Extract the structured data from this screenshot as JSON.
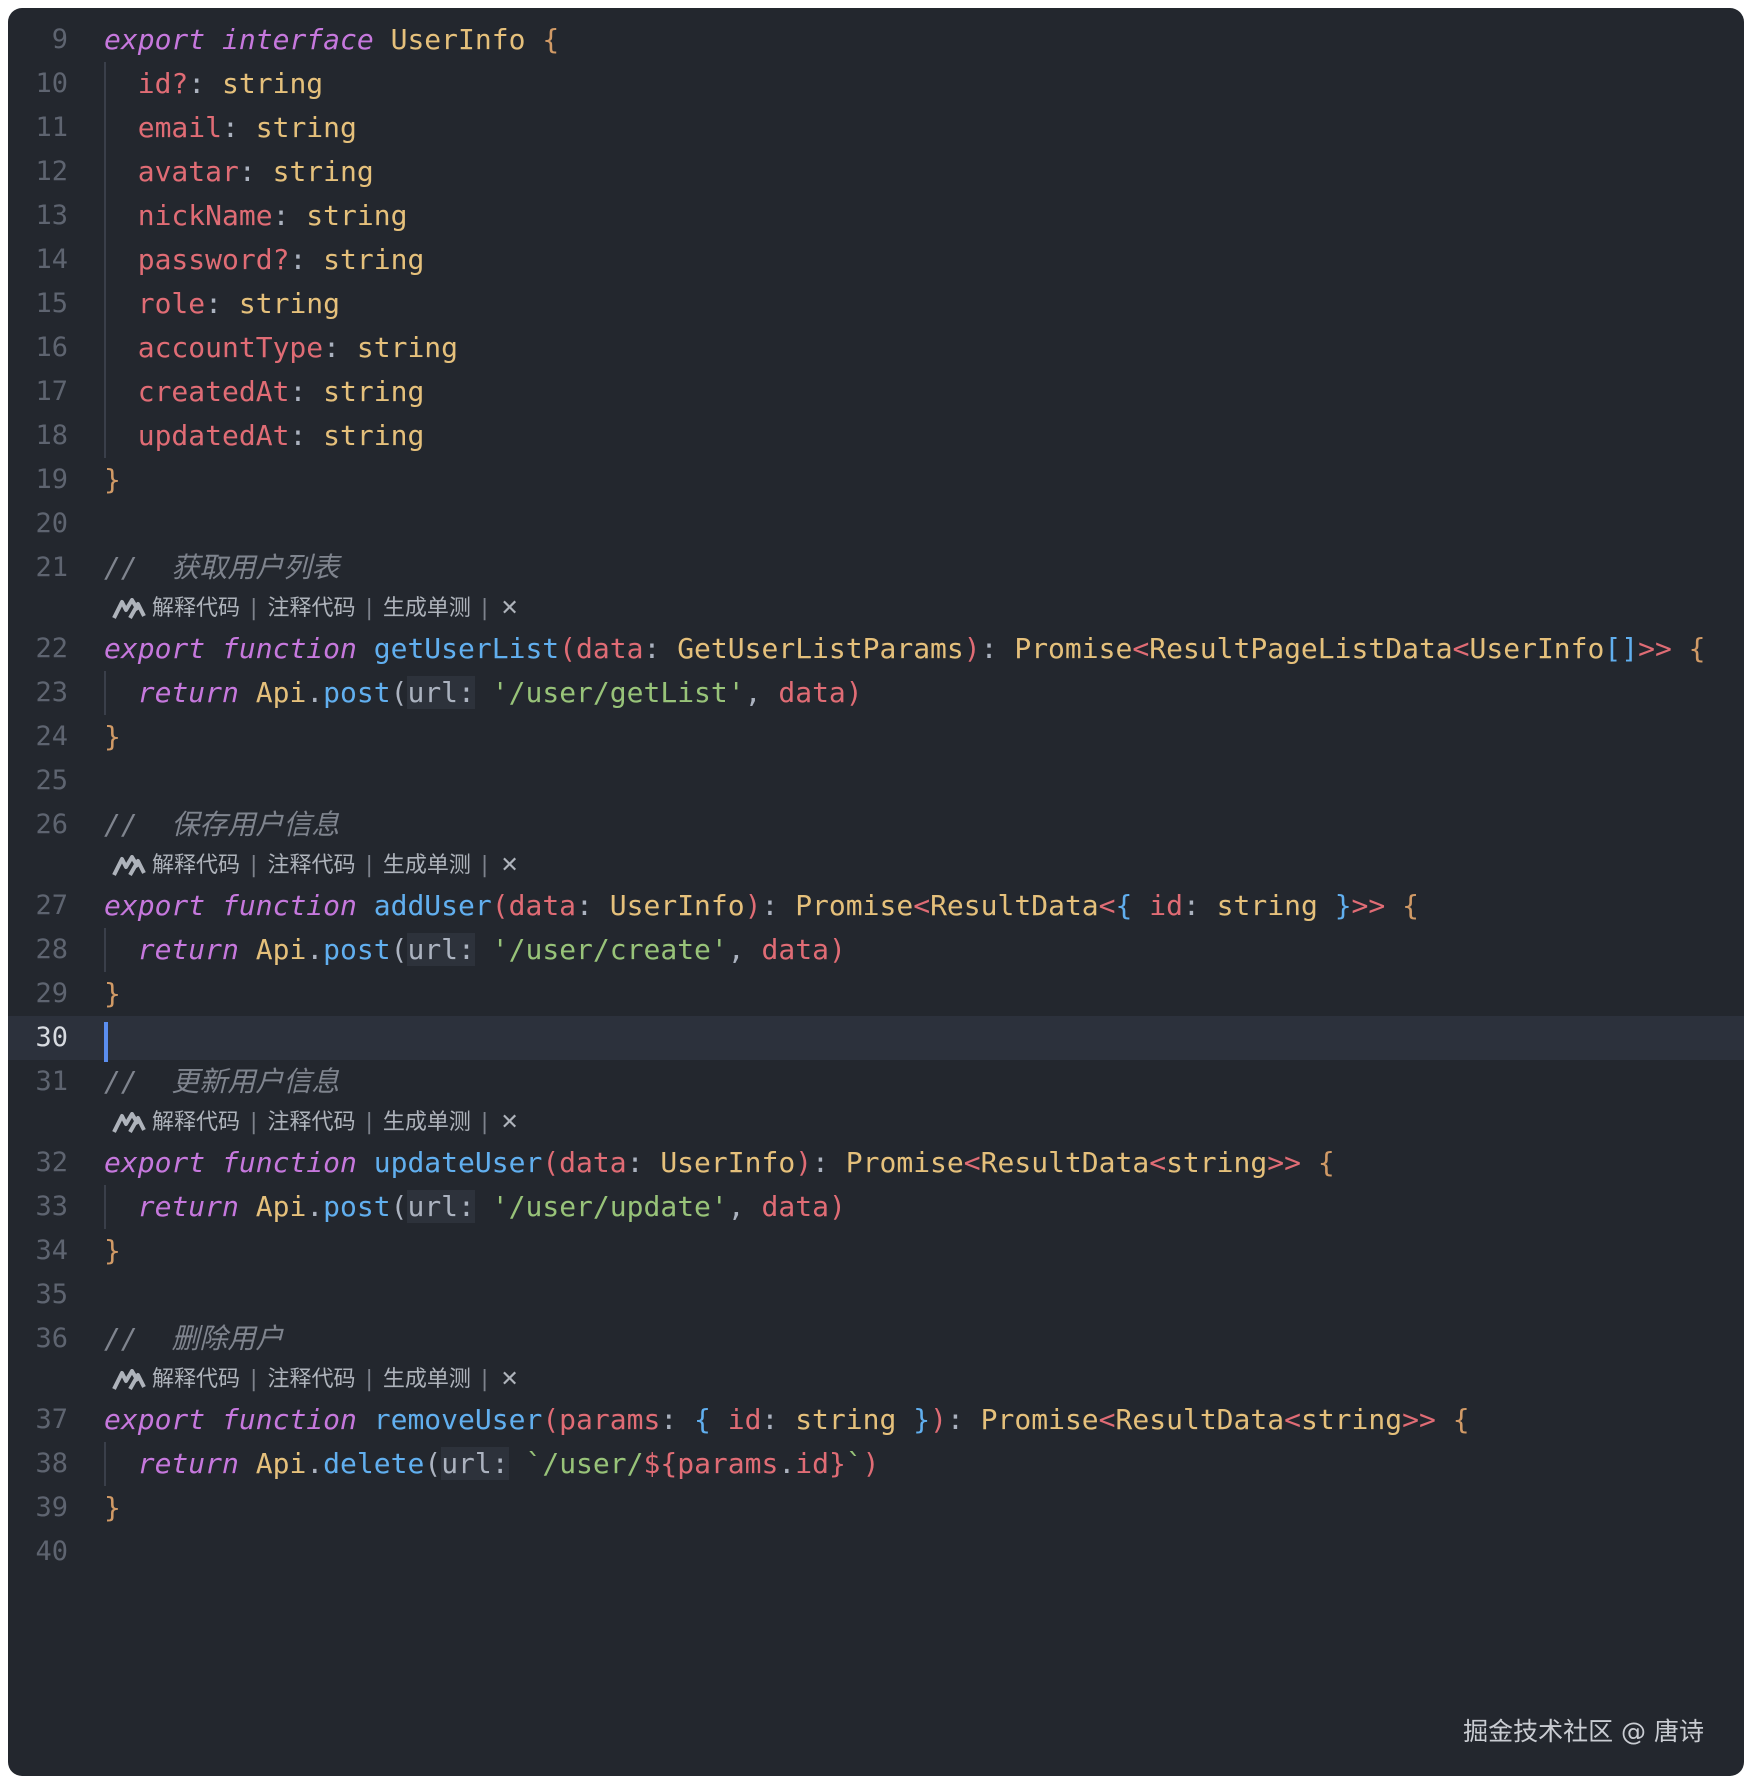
{
  "editor": {
    "active_line": 30,
    "lines": [
      {
        "n": "9",
        "tokens": [
          [
            "kw",
            "export"
          ],
          [
            "pu",
            " "
          ],
          [
            "kw",
            "interface"
          ],
          [
            "pu",
            " "
          ],
          [
            "ty",
            "UserInfo"
          ],
          [
            "pu",
            " "
          ],
          [
            "br",
            "{"
          ]
        ]
      },
      {
        "n": "10",
        "guide": true,
        "tokens": [
          [
            "pu",
            "  "
          ],
          [
            "pr",
            "id?"
          ],
          [
            "pu",
            ": "
          ],
          [
            "ty",
            "string"
          ]
        ]
      },
      {
        "n": "11",
        "guide": true,
        "tokens": [
          [
            "pu",
            "  "
          ],
          [
            "pr",
            "email"
          ],
          [
            "pu",
            ": "
          ],
          [
            "ty",
            "string"
          ]
        ]
      },
      {
        "n": "12",
        "guide": true,
        "tokens": [
          [
            "pu",
            "  "
          ],
          [
            "pr",
            "avatar"
          ],
          [
            "pu",
            ": "
          ],
          [
            "ty",
            "string"
          ]
        ]
      },
      {
        "n": "13",
        "guide": true,
        "tokens": [
          [
            "pu",
            "  "
          ],
          [
            "pr",
            "nickName"
          ],
          [
            "pu",
            ": "
          ],
          [
            "ty",
            "string"
          ]
        ]
      },
      {
        "n": "14",
        "guide": true,
        "tokens": [
          [
            "pu",
            "  "
          ],
          [
            "pr",
            "password?"
          ],
          [
            "pu",
            ": "
          ],
          [
            "ty",
            "string"
          ]
        ]
      },
      {
        "n": "15",
        "guide": true,
        "tokens": [
          [
            "pu",
            "  "
          ],
          [
            "pr",
            "role"
          ],
          [
            "pu",
            ": "
          ],
          [
            "ty",
            "string"
          ]
        ]
      },
      {
        "n": "16",
        "guide": true,
        "tokens": [
          [
            "pu",
            "  "
          ],
          [
            "pr",
            "accountType"
          ],
          [
            "pu",
            ": "
          ],
          [
            "ty",
            "string"
          ]
        ]
      },
      {
        "n": "17",
        "guide": true,
        "tokens": [
          [
            "pu",
            "  "
          ],
          [
            "pr",
            "createdAt"
          ],
          [
            "pu",
            ": "
          ],
          [
            "ty",
            "string"
          ]
        ]
      },
      {
        "n": "18",
        "guide": true,
        "tokens": [
          [
            "pu",
            "  "
          ],
          [
            "pr",
            "updatedAt"
          ],
          [
            "pu",
            ": "
          ],
          [
            "ty",
            "string"
          ]
        ]
      },
      {
        "n": "19",
        "tokens": [
          [
            "br",
            "}"
          ]
        ]
      },
      {
        "n": "20",
        "tokens": []
      },
      {
        "n": "21",
        "tokens": [
          [
            "cm",
            "//  获取用户列表"
          ]
        ]
      },
      {
        "lens": true
      },
      {
        "n": "22",
        "tokens": [
          [
            "kw",
            "export"
          ],
          [
            "pu",
            " "
          ],
          [
            "kw",
            "function"
          ],
          [
            "pu",
            " "
          ],
          [
            "fn",
            "getUserList"
          ],
          [
            "pr",
            "("
          ],
          [
            "pr",
            "data"
          ],
          [
            "pu",
            ": "
          ],
          [
            "ty",
            "GetUserListParams"
          ],
          [
            "pr",
            ")"
          ],
          [
            "pu",
            ": "
          ],
          [
            "ty",
            "Promise"
          ],
          [
            "pr",
            "<"
          ],
          [
            "ty",
            "ResultPageListData"
          ],
          [
            "pr",
            "<"
          ],
          [
            "ty",
            "UserInfo"
          ],
          [
            "fn",
            "[]"
          ],
          [
            "pr",
            ">>"
          ],
          [
            "pu",
            " "
          ],
          [
            "br",
            "{"
          ]
        ]
      },
      {
        "n": "23",
        "guide": true,
        "tokens": [
          [
            "pu",
            "  "
          ],
          [
            "kw",
            "return"
          ],
          [
            "pu",
            " "
          ],
          [
            "ty",
            "Api"
          ],
          [
            "pu",
            "."
          ],
          [
            "fn",
            "post"
          ],
          [
            "pu",
            "("
          ],
          [
            "hint",
            "url:"
          ],
          [
            "pu",
            " "
          ],
          [
            "st",
            "'/user/getList'"
          ],
          [
            "pu",
            ", "
          ],
          [
            "pr",
            "data"
          ],
          [
            "pr",
            ")"
          ]
        ]
      },
      {
        "n": "24",
        "tokens": [
          [
            "br",
            "}"
          ]
        ]
      },
      {
        "n": "25",
        "tokens": []
      },
      {
        "n": "26",
        "tokens": [
          [
            "cm",
            "//  保存用户信息"
          ]
        ]
      },
      {
        "lens": true
      },
      {
        "n": "27",
        "tokens": [
          [
            "kw",
            "export"
          ],
          [
            "pu",
            " "
          ],
          [
            "kw",
            "function"
          ],
          [
            "pu",
            " "
          ],
          [
            "fn",
            "addUser"
          ],
          [
            "pr",
            "("
          ],
          [
            "pr",
            "data"
          ],
          [
            "pu",
            ": "
          ],
          [
            "ty",
            "UserInfo"
          ],
          [
            "pr",
            ")"
          ],
          [
            "pu",
            ": "
          ],
          [
            "ty",
            "Promise"
          ],
          [
            "pr",
            "<"
          ],
          [
            "ty",
            "ResultData"
          ],
          [
            "pr",
            "<"
          ],
          [
            "fn",
            "{"
          ],
          [
            "pu",
            " "
          ],
          [
            "pr",
            "id"
          ],
          [
            "pu",
            ": "
          ],
          [
            "ty",
            "string"
          ],
          [
            "pu",
            " "
          ],
          [
            "fn",
            "}"
          ],
          [
            "pr",
            ">>"
          ],
          [
            "pu",
            " "
          ],
          [
            "br",
            "{"
          ]
        ]
      },
      {
        "n": "28",
        "guide": true,
        "tokens": [
          [
            "pu",
            "  "
          ],
          [
            "kw",
            "return"
          ],
          [
            "pu",
            " "
          ],
          [
            "ty",
            "Api"
          ],
          [
            "pu",
            "."
          ],
          [
            "fn",
            "post"
          ],
          [
            "pu",
            "("
          ],
          [
            "hint",
            "url:"
          ],
          [
            "pu",
            " "
          ],
          [
            "st",
            "'/user/create'"
          ],
          [
            "pu",
            ", "
          ],
          [
            "pr",
            "data"
          ],
          [
            "pr",
            ")"
          ]
        ]
      },
      {
        "n": "29",
        "tokens": [
          [
            "br",
            "}"
          ]
        ]
      },
      {
        "n": "30",
        "tokens": []
      },
      {
        "n": "31",
        "tokens": [
          [
            "cm",
            "//  更新用户信息"
          ]
        ]
      },
      {
        "lens": true
      },
      {
        "n": "32",
        "tokens": [
          [
            "kw",
            "export"
          ],
          [
            "pu",
            " "
          ],
          [
            "kw",
            "function"
          ],
          [
            "pu",
            " "
          ],
          [
            "fn",
            "updateUser"
          ],
          [
            "pr",
            "("
          ],
          [
            "pr",
            "data"
          ],
          [
            "pu",
            ": "
          ],
          [
            "ty",
            "UserInfo"
          ],
          [
            "pr",
            ")"
          ],
          [
            "pu",
            ": "
          ],
          [
            "ty",
            "Promise"
          ],
          [
            "pr",
            "<"
          ],
          [
            "ty",
            "ResultData"
          ],
          [
            "pr",
            "<"
          ],
          [
            "ty",
            "string"
          ],
          [
            "pr",
            ">>"
          ],
          [
            "pu",
            " "
          ],
          [
            "br",
            "{"
          ]
        ]
      },
      {
        "n": "33",
        "guide": true,
        "tokens": [
          [
            "pu",
            "  "
          ],
          [
            "kw",
            "return"
          ],
          [
            "pu",
            " "
          ],
          [
            "ty",
            "Api"
          ],
          [
            "pu",
            "."
          ],
          [
            "fn",
            "post"
          ],
          [
            "pu",
            "("
          ],
          [
            "hint",
            "url:"
          ],
          [
            "pu",
            " "
          ],
          [
            "st",
            "'/user/update'"
          ],
          [
            "pu",
            ", "
          ],
          [
            "pr",
            "data"
          ],
          [
            "pr",
            ")"
          ]
        ]
      },
      {
        "n": "34",
        "tokens": [
          [
            "br",
            "}"
          ]
        ]
      },
      {
        "n": "35",
        "tokens": []
      },
      {
        "n": "36",
        "tokens": [
          [
            "cm",
            "//  删除用户"
          ]
        ]
      },
      {
        "lens": true
      },
      {
        "n": "37",
        "tokens": [
          [
            "kw",
            "export"
          ],
          [
            "pu",
            " "
          ],
          [
            "kw",
            "function"
          ],
          [
            "pu",
            " "
          ],
          [
            "fn",
            "removeUser"
          ],
          [
            "pr",
            "("
          ],
          [
            "pr",
            "params"
          ],
          [
            "pu",
            ": "
          ],
          [
            "fn",
            "{"
          ],
          [
            "pu",
            " "
          ],
          [
            "pr",
            "id"
          ],
          [
            "pu",
            ": "
          ],
          [
            "ty",
            "string"
          ],
          [
            "pu",
            " "
          ],
          [
            "fn",
            "}"
          ],
          [
            "pr",
            ")"
          ],
          [
            "pu",
            ": "
          ],
          [
            "ty",
            "Promise"
          ],
          [
            "pr",
            "<"
          ],
          [
            "ty",
            "ResultData"
          ],
          [
            "pr",
            "<"
          ],
          [
            "ty",
            "string"
          ],
          [
            "pr",
            ">>"
          ],
          [
            "pu",
            " "
          ],
          [
            "br",
            "{"
          ]
        ]
      },
      {
        "n": "38",
        "guide": true,
        "tokens": [
          [
            "pu",
            "  "
          ],
          [
            "kw",
            "return"
          ],
          [
            "pu",
            " "
          ],
          [
            "ty",
            "Api"
          ],
          [
            "pu",
            "."
          ],
          [
            "fn",
            "delete"
          ],
          [
            "pu",
            "("
          ],
          [
            "hint",
            "url:"
          ],
          [
            "pu",
            " "
          ],
          [
            "st",
            "`/user/"
          ],
          [
            "pr",
            "${"
          ],
          [
            "pr",
            "params"
          ],
          [
            "pu",
            "."
          ],
          [
            "pr",
            "id"
          ],
          [
            "pr",
            "}"
          ],
          [
            "st",
            "`"
          ],
          [
            "pr",
            ")"
          ]
        ]
      },
      {
        "n": "39",
        "tokens": [
          [
            "br",
            "}"
          ]
        ]
      },
      {
        "n": "40",
        "tokens": []
      }
    ]
  },
  "code_lens": {
    "explain": "解释代码",
    "comment": "注释代码",
    "unit_test": "生成单测",
    "separator": "|",
    "close": "✕",
    "logo_icon": "marscode-logo-icon"
  },
  "watermark": "掘金技术社区 @ 唐诗"
}
